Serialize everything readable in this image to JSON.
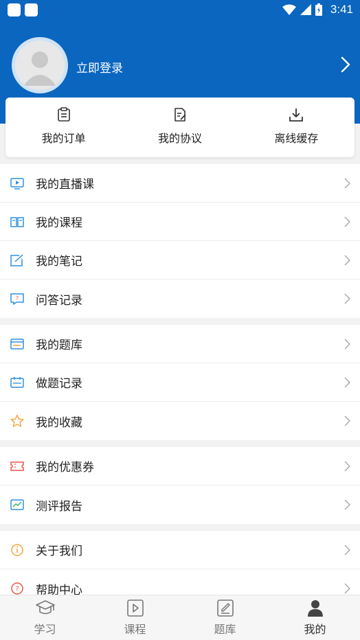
{
  "status_bar": {
    "time": "3:41"
  },
  "profile": {
    "login_label": "立即登录"
  },
  "quick_actions": [
    {
      "label": "我的订单",
      "icon": "order-clipboard-icon"
    },
    {
      "label": "我的协议",
      "icon": "agreement-document-icon"
    },
    {
      "label": "离线缓存",
      "icon": "download-icon"
    }
  ],
  "menu_groups": [
    [
      {
        "label": "我的直播课",
        "icon": "live-class-icon"
      },
      {
        "label": "我的课程",
        "icon": "course-book-icon"
      },
      {
        "label": "我的笔记",
        "icon": "notes-pencil-icon"
      },
      {
        "label": "问答记录",
        "icon": "qa-chat-icon"
      }
    ],
    [
      {
        "label": "我的题库",
        "icon": "question-bank-icon"
      },
      {
        "label": "做题记录",
        "icon": "practice-record-icon"
      },
      {
        "label": "我的收藏",
        "icon": "star-icon"
      }
    ],
    [
      {
        "label": "我的优惠券",
        "icon": "coupon-icon"
      },
      {
        "label": "测评报告",
        "icon": "report-chart-icon"
      }
    ],
    [
      {
        "label": "关于我们",
        "icon": "info-icon"
      },
      {
        "label": "帮助中心",
        "icon": "help-icon"
      }
    ]
  ],
  "tabs": [
    {
      "label": "学习",
      "icon": "graduation-cap-icon",
      "active": false
    },
    {
      "label": "课程",
      "icon": "play-video-icon",
      "active": false
    },
    {
      "label": "题库",
      "icon": "edit-document-icon",
      "active": false
    },
    {
      "label": "我的",
      "icon": "user-profile-icon",
      "active": true
    }
  ],
  "colors": {
    "header_blue": "#0a66bf",
    "icon_blue": "#2f8fe0",
    "icon_orange": "#f3a33a",
    "icon_red": "#e8564a",
    "icon_green": "#3cb371"
  }
}
